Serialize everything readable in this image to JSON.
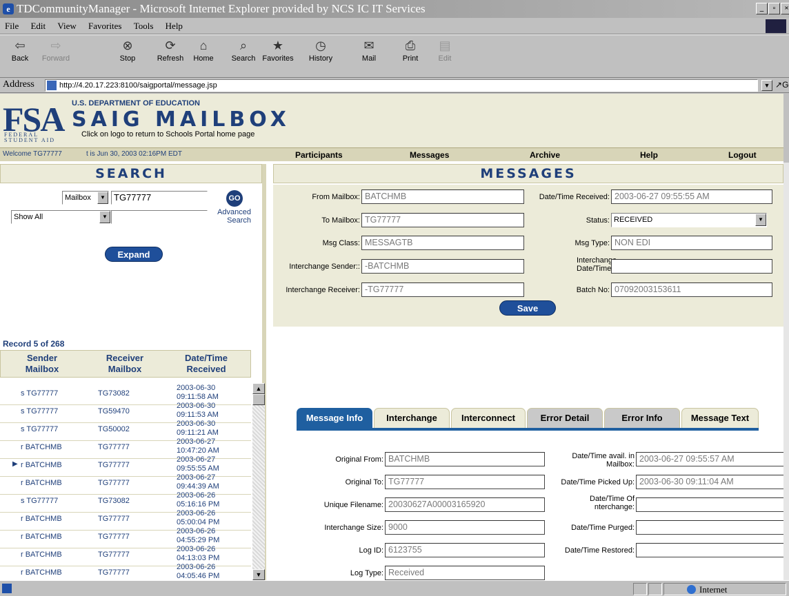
{
  "browser": {
    "title": "TDCommunityManager - Microsoft Internet Explorer provided by NCS IC IT Services",
    "menu": [
      "File",
      "Edit",
      "View",
      "Favorites",
      "Tools",
      "Help"
    ],
    "toolbar": [
      {
        "label": "Back",
        "icon": "back-arrow-icon",
        "glyph": "⇦",
        "enabled": true
      },
      {
        "label": "Forward",
        "icon": "forward-arrow-icon",
        "glyph": "⇨",
        "enabled": false
      },
      {
        "label": "Stop",
        "icon": "stop-icon",
        "glyph": "⊗",
        "enabled": true
      },
      {
        "label": "Refresh",
        "icon": "refresh-icon",
        "glyph": "⟳",
        "enabled": true
      },
      {
        "label": "Home",
        "icon": "home-icon",
        "glyph": "⌂",
        "enabled": true
      },
      {
        "label": "Search",
        "icon": "search-icon",
        "glyph": "⌕",
        "enabled": true
      },
      {
        "label": "Favorites",
        "icon": "favorites-icon",
        "glyph": "★",
        "enabled": true
      },
      {
        "label": "History",
        "icon": "history-icon",
        "glyph": "◷",
        "enabled": true
      },
      {
        "label": "Mail",
        "icon": "mail-icon",
        "glyph": "✉",
        "enabled": true
      },
      {
        "label": "Print",
        "icon": "print-icon",
        "glyph": "⎙",
        "enabled": true
      },
      {
        "label": "Edit",
        "icon": "edit-icon",
        "glyph": "▤",
        "enabled": false
      }
    ],
    "address_label": "Address",
    "address": "http://4.20.17.223:8100/saigportal/message.jsp",
    "go_label": "Go",
    "status_zone": "Internet"
  },
  "header": {
    "logo_big": "FSA",
    "logo_small": "FEDERAL STUDENT AID",
    "department": "U.S. DEPARTMENT OF EDUCATION",
    "title": "SAIG MAILBOX",
    "hint": "Click on logo to return to Schools Portal home page"
  },
  "navbar": {
    "welcome": "Welcome TG77777",
    "date": "t is Jun 30, 2003 02:16PM EDT",
    "items": [
      "Participants",
      "Messages",
      "Archive",
      "Help",
      "Logout"
    ]
  },
  "search": {
    "title": "SEARCH",
    "scope": "Mailbox",
    "mailbox_value": "TG77777",
    "go_label": "GO",
    "filter": "Show All",
    "filter_value": "",
    "advanced": "Advanced Search",
    "expand_label": "Expand",
    "record_count": "Record 5 of 268",
    "columns": [
      "Sender Mailbox",
      "Receiver Mailbox",
      "Date/Time Received"
    ],
    "rows": [
      {
        "sender": "s TG77777",
        "receiver": "TG73082",
        "date": "2003-06-30",
        "time": "09:11:58 AM",
        "current": false
      },
      {
        "sender": "s TG77777",
        "receiver": "TG59470",
        "date": "2003-06-30",
        "time": "09:11:53 AM",
        "current": false
      },
      {
        "sender": "s TG77777",
        "receiver": "TG50002",
        "date": "2003-06-30",
        "time": "09:11:21 AM",
        "current": false
      },
      {
        "sender": "r BATCHMB",
        "receiver": "TG77777",
        "date": "2003-06-27",
        "time": "10:47:20 AM",
        "current": false
      },
      {
        "sender": "r BATCHMB",
        "receiver": "TG77777",
        "date": "2003-06-27",
        "time": "09:55:55 AM",
        "current": true
      },
      {
        "sender": "r BATCHMB",
        "receiver": "TG77777",
        "date": "2003-06-27",
        "time": "09:44:39 AM",
        "current": false
      },
      {
        "sender": "s TG77777",
        "receiver": "TG73082",
        "date": "2003-06-26",
        "time": "05:16:16 PM",
        "current": false
      },
      {
        "sender": "r BATCHMB",
        "receiver": "TG77777",
        "date": "2003-06-26",
        "time": "05:00:04 PM",
        "current": false
      },
      {
        "sender": "r BATCHMB",
        "receiver": "TG77777",
        "date": "2003-06-26",
        "time": "04:55:29 PM",
        "current": false
      },
      {
        "sender": "r BATCHMB",
        "receiver": "TG77777",
        "date": "2003-06-26",
        "time": "04:13:03 PM",
        "current": false
      },
      {
        "sender": "r BATCHMB",
        "receiver": "TG77777",
        "date": "2003-06-26",
        "time": "04:05:46 PM",
        "current": false
      }
    ]
  },
  "messages": {
    "title": "MESSAGES",
    "fields": {
      "from_mailbox": {
        "label": "From Mailbox:",
        "value": "BATCHMB"
      },
      "datetime_received": {
        "label": "Date/Time Received:",
        "value": "2003-06-27 09:55:55 AM"
      },
      "to_mailbox": {
        "label": "To Mailbox:",
        "value": "TG77777"
      },
      "status": {
        "label": "Status:",
        "value": "RECEIVED"
      },
      "msg_class": {
        "label": "Msg Class:",
        "value": "MESSAGTB"
      },
      "msg_type": {
        "label": "Msg Type:",
        "value": "NON EDI"
      },
      "interchange_sender": {
        "label": "Interchange Sender::",
        "value": "-BATCHMB"
      },
      "interchange_datetime": {
        "label": "Interchange Date/Time:",
        "value": ""
      },
      "interchange_receiver": {
        "label": "Interchange Receiver:",
        "value": "-TG77777"
      },
      "batch_no": {
        "label": "Batch No:",
        "value": "07092003153611"
      }
    },
    "save_label": "Save",
    "tabs": [
      "Message Info",
      "Interchange",
      "Interconnect",
      "Error Detail",
      "Error Info",
      "Message Text"
    ],
    "info": {
      "original_from": {
        "label": "Original From:",
        "value": "BATCHMB"
      },
      "datetime_avail": {
        "label": "Date/Time avail. in Mailbox:",
        "value": "2003-06-27 09:55:57 AM"
      },
      "original_to": {
        "label": "Original To:",
        "value": "TG77777"
      },
      "datetime_picked": {
        "label": "Date/Time Picked Up:",
        "value": "2003-06-30 09:11:04 AM"
      },
      "unique_filename": {
        "label": "Unique Filename:",
        "value": "20030627A00003165920"
      },
      "datetime_interchange": {
        "label": "Date/Time Of nterchange:",
        "value": ""
      },
      "interchange_size": {
        "label": "Interchange Size:",
        "value": "9000"
      },
      "datetime_purged": {
        "label": "Date/Time Purged:",
        "value": ""
      },
      "log_id": {
        "label": "Log ID:",
        "value": "6123755"
      },
      "datetime_restored": {
        "label": "Date/Time Restored:",
        "value": ""
      },
      "log_type": {
        "label": "Log Type:",
        "value": "Received"
      }
    }
  },
  "colors": {
    "brand": "#1f3f7a",
    "accent": "#1f5fa0",
    "panel": "#ecebd9"
  }
}
